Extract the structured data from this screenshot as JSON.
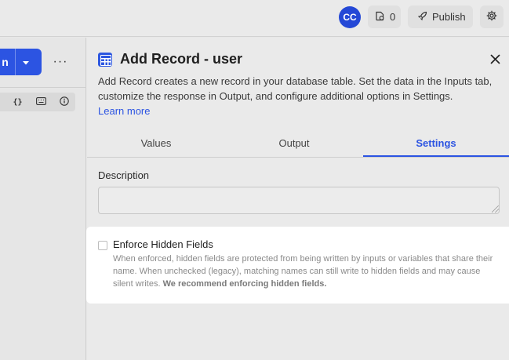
{
  "topbar": {
    "avatar_initials": "CC",
    "deploy_count": "0",
    "publish_label": "Publish"
  },
  "left_panel": {
    "run_label": "n",
    "more_label": "···",
    "icon_buttons": [
      "braces-icon",
      "keyboard-icon",
      "info-icon"
    ]
  },
  "panel": {
    "title": "Add Record - user",
    "description": "Add Record creates a new record in your database table. Set the data in the Inputs tab, customize the response in Output, and configure additional options in Settings.",
    "learn_more": "Learn more",
    "tabs": [
      {
        "label": "Values",
        "active": false
      },
      {
        "label": "Output",
        "active": false
      },
      {
        "label": "Settings",
        "active": true
      }
    ],
    "description_field": {
      "label": "Description",
      "value": "",
      "placeholder": ""
    }
  },
  "hidden_fields": {
    "title": "Enforce Hidden Fields",
    "checked": false,
    "help": "When enforced, hidden fields are protected from being written by inputs or variables that share their name. When unchecked (legacy), matching names can still write to hidden fields and may cause silent writes.",
    "help_bold": "We recommend enforcing hidden fields."
  },
  "colors": {
    "accent": "#2c54e2",
    "avatar": "#2448d6"
  }
}
